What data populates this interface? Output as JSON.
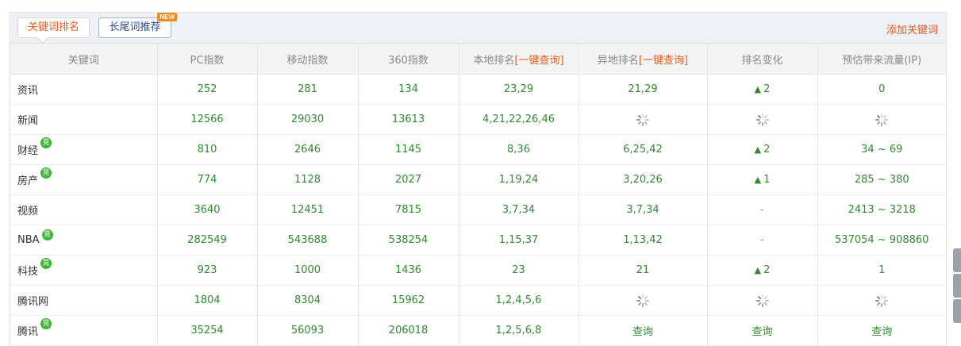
{
  "tabs": [
    {
      "label": "关键词排名",
      "active": true
    },
    {
      "label": "长尾词推荐",
      "active": false,
      "badge": "NEW"
    }
  ],
  "add_keyword_label": "添加关键词",
  "columns": {
    "keyword": "关键词",
    "pc_index": "PC指数",
    "mobile_index": "移动指数",
    "index_360": "360指数",
    "local_rank": "本地排名",
    "remote_rank": "异地排名",
    "one_click_query": "[一键查询]",
    "rank_change": "排名变化",
    "traffic": "预估带来流量(IP)"
  },
  "jing_badge": "竞",
  "query_label": "查询",
  "rows": [
    {
      "keyword": "资讯",
      "jing": false,
      "pc": "252",
      "mobile": "281",
      "s360": "134",
      "local": "23,29",
      "remote": "21,29",
      "change": "2",
      "change_type": "up",
      "traffic": "0"
    },
    {
      "keyword": "新闻",
      "jing": false,
      "pc": "12566",
      "mobile": "29030",
      "s360": "13613",
      "local": "4,21,22,26,46",
      "remote": "",
      "remote_type": "loading",
      "change": "",
      "change_type": "loading",
      "traffic": "",
      "traffic_type": "loading"
    },
    {
      "keyword": "财经",
      "jing": true,
      "pc": "810",
      "mobile": "2646",
      "s360": "1145",
      "local": "8,36",
      "remote": "6,25,42",
      "change": "2",
      "change_type": "up",
      "traffic": "34 ~ 69"
    },
    {
      "keyword": "房产",
      "jing": true,
      "pc": "774",
      "mobile": "1128",
      "s360": "2027",
      "local": "1,19,24",
      "remote": "3,20,26",
      "change": "1",
      "change_type": "up",
      "traffic": "285 ~ 380"
    },
    {
      "keyword": "视频",
      "jing": false,
      "pc": "3640",
      "mobile": "12451",
      "s360": "7815",
      "local": "3,7,34",
      "remote": "3,7,34",
      "change": "-",
      "change_type": "none",
      "traffic": "2413 ~ 3218"
    },
    {
      "keyword": "NBA",
      "jing": true,
      "pc": "282549",
      "mobile": "543688",
      "s360": "538254",
      "local": "1,15,37",
      "remote": "1,13,42",
      "change": "-",
      "change_type": "none",
      "traffic": "537054 ~ 908860"
    },
    {
      "keyword": "科技",
      "jing": true,
      "pc": "923",
      "mobile": "1000",
      "s360": "1436",
      "local": "23",
      "remote": "21",
      "change": "2",
      "change_type": "up",
      "traffic": "1"
    },
    {
      "keyword": "腾讯网",
      "jing": false,
      "pc": "1804",
      "mobile": "8304",
      "s360": "15962",
      "local": "1,2,4,5,6",
      "remote": "",
      "remote_type": "loading",
      "change": "",
      "change_type": "loading",
      "traffic": "",
      "traffic_type": "loading"
    },
    {
      "keyword": "腾讯",
      "jing": true,
      "pc": "35254",
      "mobile": "56093",
      "s360": "206018",
      "local": "1,2,5,6,8",
      "remote": "查询",
      "remote_type": "query",
      "change": "查询",
      "change_type": "query",
      "traffic": "查询",
      "traffic_type": "query"
    }
  ],
  "icons": {
    "rank_up": "arrow-up-icon",
    "loading": "spinner-icon"
  },
  "colors": {
    "accent": "#e55a1c",
    "value_green": "#2f8a2f",
    "tab_blue": "#2a4f8a",
    "badge_orange": "#f08a19",
    "jing_green": "#3cb532"
  }
}
